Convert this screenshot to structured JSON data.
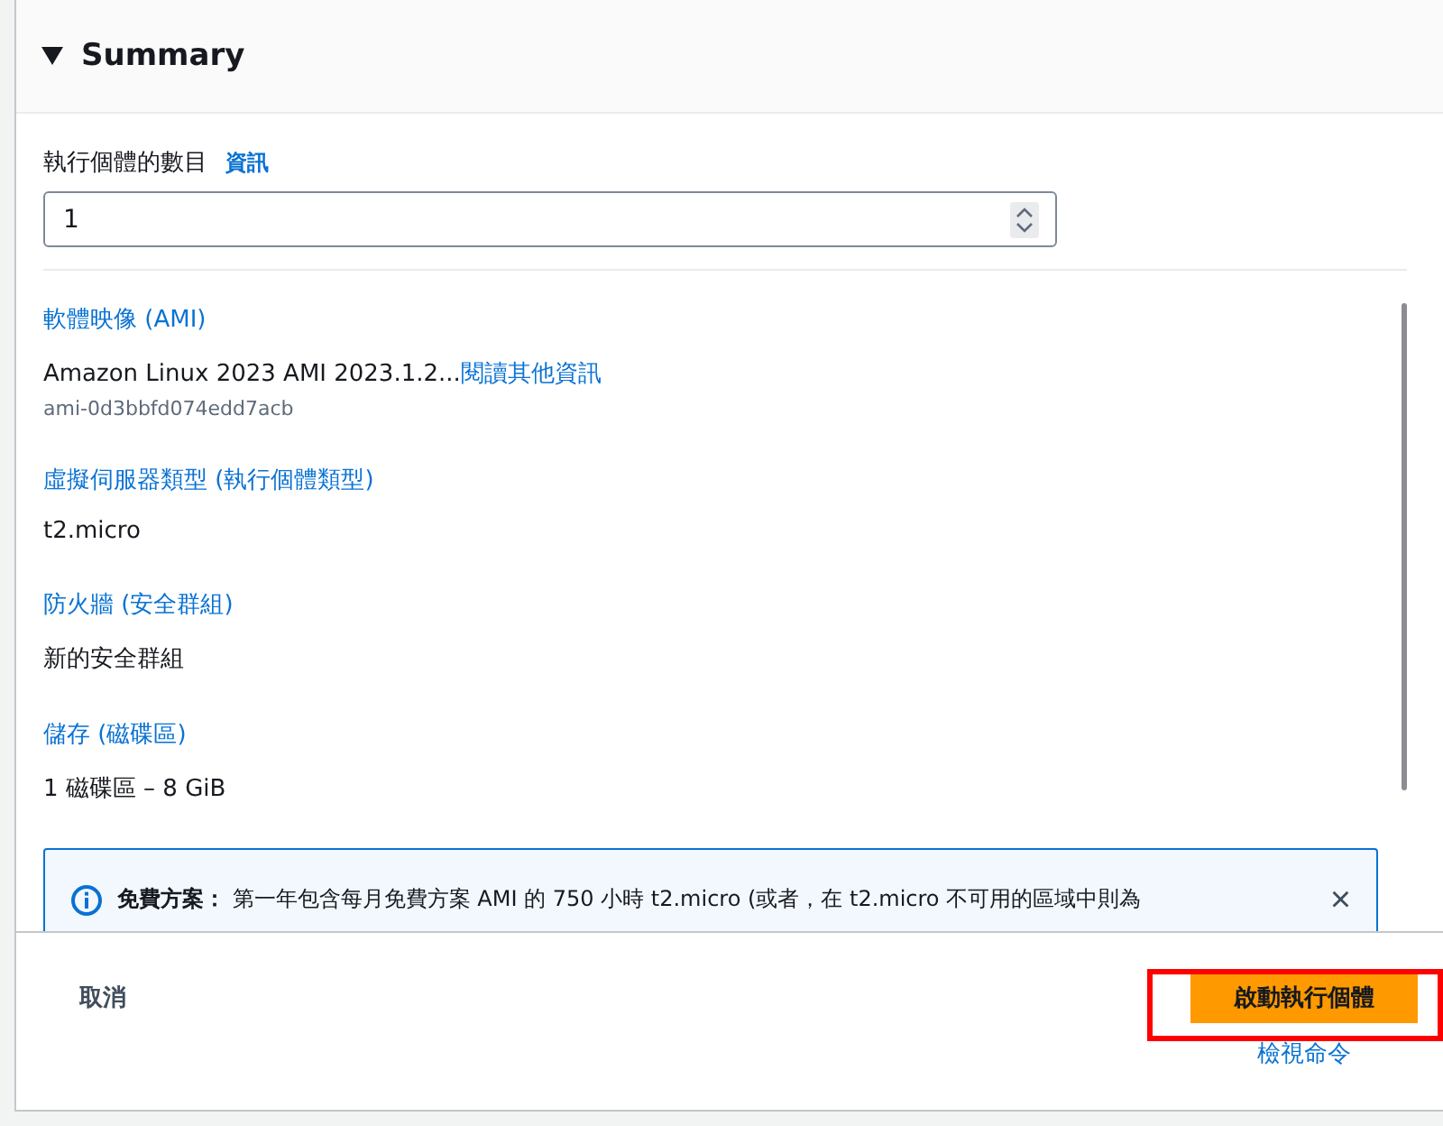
{
  "panel": {
    "title": "Summary",
    "expanded": true
  },
  "instance_count": {
    "label": "執行個體的數目",
    "info_link": "資訊",
    "value": "1"
  },
  "sections": [
    {
      "heading": "軟體映像 (AMI)",
      "value": "Amazon Linux 2023 AMI 2023.1.2...",
      "link": "閱讀其他資訊",
      "sub": "ami-0d3bbfd074edd7acb"
    },
    {
      "heading": "虛擬伺服器類型 (執行個體類型)",
      "value": "t2.micro"
    },
    {
      "heading": "防火牆 (安全群組)",
      "value": "新的安全群組"
    },
    {
      "heading": "儲存 (磁碟區)",
      "value": "1 磁碟區 – 8 GiB"
    }
  ],
  "alert": {
    "text": "**免費方案：** 第一年包含每月免費方案 AMI 的 750 小時 t2.micro (或者，在 t2.micro 不可用的區域中則為",
    "close": "×"
  },
  "footer": {
    "cancel": "取消",
    "launch": "啟動執行個體",
    "view_command": "檢視命令"
  }
}
